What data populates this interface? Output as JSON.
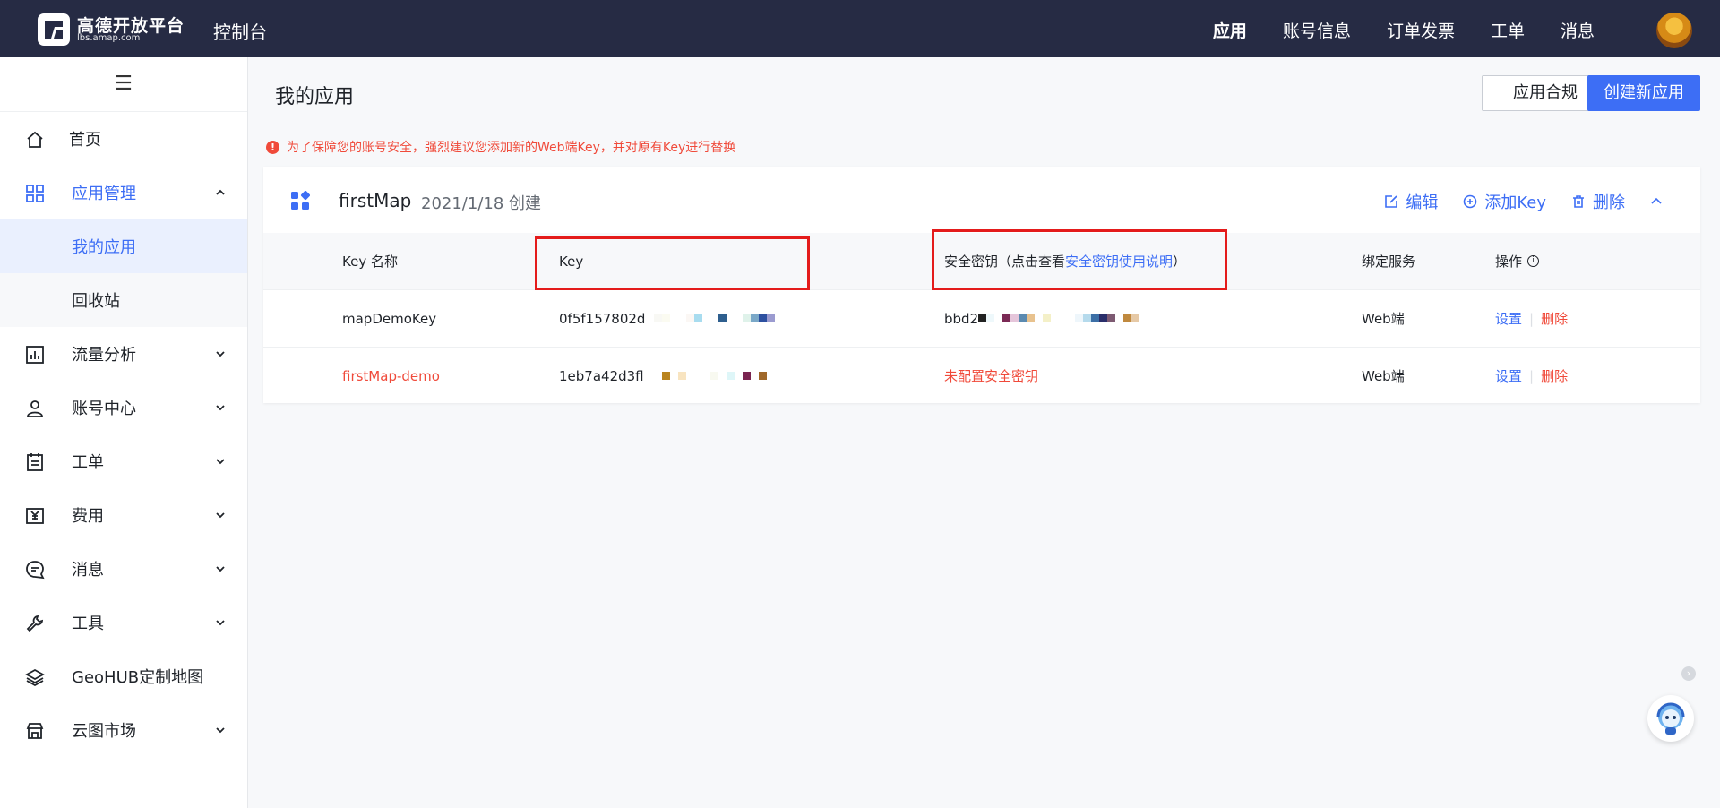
{
  "header": {
    "logo_name": "高德开放平台",
    "logo_sub": "lbs.amap.com",
    "console": "控制台",
    "nav": [
      "应用",
      "账号信息",
      "订单发票",
      "工单",
      "消息"
    ]
  },
  "sidebar": {
    "items": [
      {
        "label": "首页",
        "icon": "home-icon"
      },
      {
        "label": "应用管理",
        "icon": "grid-icon"
      },
      {
        "label": "我的应用"
      },
      {
        "label": "回收站"
      },
      {
        "label": "流量分析",
        "icon": "chart-icon"
      },
      {
        "label": "账号中心",
        "icon": "user-icon"
      },
      {
        "label": "工单",
        "icon": "clipboard-icon"
      },
      {
        "label": "费用",
        "icon": "yuan-icon"
      },
      {
        "label": "消息",
        "icon": "message-icon"
      },
      {
        "label": "工具",
        "icon": "wrench-icon"
      },
      {
        "label": "GeoHUB定制地图",
        "icon": "layers-icon"
      },
      {
        "label": "云图市场",
        "icon": "store-icon"
      }
    ]
  },
  "main": {
    "title": "我的应用",
    "compliance_btn": "应用合规",
    "create_btn": "创建新应用",
    "warning": "为了保障您的账号安全，强烈建议您添加新的Web端Key，并对原有Key进行替换",
    "app": {
      "name": "firstMap",
      "created": "2021/1/18 创建",
      "edit": "编辑",
      "add_key": "添加Key",
      "delete": "删除"
    },
    "table": {
      "headers": {
        "key_name": "Key 名称",
        "key": "Key",
        "secret_prefix": "安全密钥（点击查看",
        "secret_link": "安全密钥使用说明",
        "secret_suffix": "）",
        "service": "绑定服务",
        "ops": "操作"
      },
      "rows": [
        {
          "name": "mapDemoKey",
          "key": "0f5f157802d",
          "secret": "bbd2",
          "service": "Web端",
          "set": "设置",
          "del": "删除"
        },
        {
          "name": "firstMap-demo",
          "key": "1eb7a42d3fl",
          "secret": "未配置安全密钥",
          "service": "Web端",
          "set": "设置",
          "del": "删除"
        }
      ]
    }
  },
  "colors": {
    "topbar": "#262b44",
    "primary": "#3d6ef5",
    "danger": "#f04a3a",
    "highlight": "#e41b1b"
  }
}
